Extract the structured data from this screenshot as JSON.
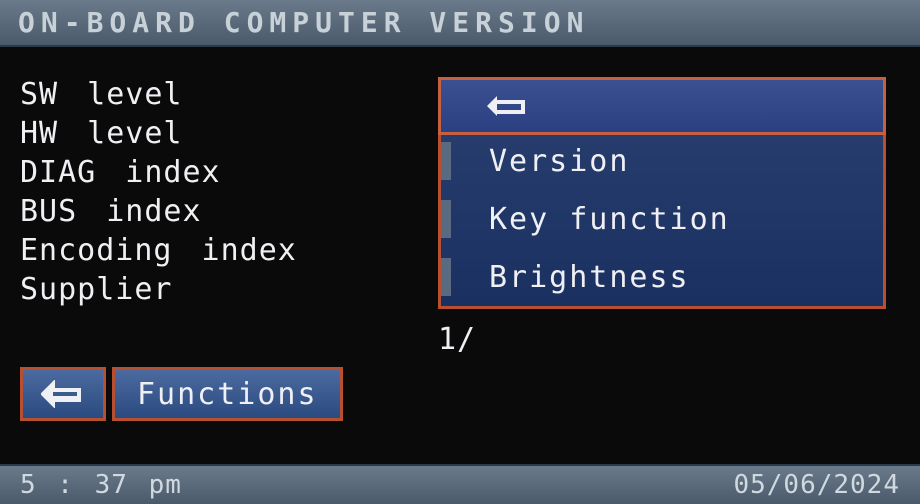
{
  "header": {
    "title": "ON-BOARD COMPUTER VERSION"
  },
  "left_list": {
    "items": [
      "SW level",
      "HW level",
      "DIAG index",
      "BUS index",
      "Encoding index",
      "Supplier"
    ]
  },
  "page_indicator": "1/",
  "bottom_nav": {
    "back_icon": "back-icon",
    "functions_label": "Functions"
  },
  "popup": {
    "items": [
      {
        "label": "",
        "icon": "back-icon",
        "selected": true
      },
      {
        "label": "Version",
        "selected": false
      },
      {
        "label": "Key function",
        "selected": false
      },
      {
        "label": "Brightness",
        "selected": false
      }
    ]
  },
  "statusbar": {
    "time": "5 : 37 pm",
    "date": "05/06/2024"
  }
}
